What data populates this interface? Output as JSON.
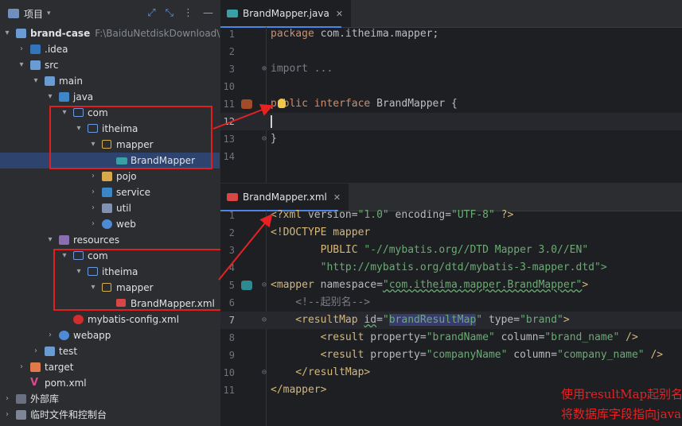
{
  "project_panel": {
    "title": "项目",
    "tree": [
      {
        "label": "brand-case",
        "hint": "F:\\BaiduNetdiskDownload\\资",
        "icon": "module-folder-icon",
        "bold": true
      },
      {
        "label": ".idea",
        "icon": "idea-folder-icon"
      },
      {
        "label": "src",
        "icon": "src-folder-icon"
      },
      {
        "label": "main",
        "icon": "folder-icon"
      },
      {
        "label": "java",
        "icon": "java-source-root-icon"
      },
      {
        "label": "com",
        "icon": "package-icon"
      },
      {
        "label": "itheima",
        "icon": "package-icon"
      },
      {
        "label": "mapper",
        "icon": "package-icon"
      },
      {
        "label": "BrandMapper",
        "icon": "mybatis-interface-icon"
      },
      {
        "label": "pojo",
        "icon": "package-icon"
      },
      {
        "label": "service",
        "icon": "package-icon"
      },
      {
        "label": "util",
        "icon": "package-icon"
      },
      {
        "label": "web",
        "icon": "package-icon"
      },
      {
        "label": "resources",
        "icon": "resources-root-icon"
      },
      {
        "label": "com",
        "icon": "folder-icon"
      },
      {
        "label": "itheima",
        "icon": "folder-icon"
      },
      {
        "label": "mapper",
        "icon": "folder-icon"
      },
      {
        "label": "BrandMapper.xml",
        "icon": "mapper-xml-icon"
      },
      {
        "label": "mybatis-config.xml",
        "icon": "mybatis-xml-icon"
      },
      {
        "label": "webapp",
        "icon": "web-folder-icon"
      },
      {
        "label": "test",
        "icon": "folder-icon"
      },
      {
        "label": "target",
        "icon": "excluded-folder-icon"
      },
      {
        "label": "pom.xml",
        "icon": "maven-icon"
      },
      {
        "label": "外部库",
        "icon": "library-icon"
      },
      {
        "label": "临时文件和控制台",
        "icon": "scratch-icon"
      }
    ]
  },
  "editor_java": {
    "tab": "BrandMapper.java",
    "tab_close": "✕",
    "lines": [
      {
        "n": "1"
      },
      {
        "n": "2"
      },
      {
        "n": "3"
      },
      {
        "n": "10"
      },
      {
        "n": "11"
      },
      {
        "n": "12"
      },
      {
        "n": "13"
      },
      {
        "n": "14"
      }
    ],
    "code": {
      "package_kw": "package",
      "package_name": " com.itheima.mapper;",
      "import_text": "import ...",
      "iface_pre": "p",
      "iface_rest": "ublic",
      "interface_kw": " interface",
      "class_name": " BrandMapper {",
      "close_brace": "}"
    }
  },
  "editor_xml": {
    "tab": "BrandMapper.xml",
    "tab_close": "✕",
    "lines": [
      {
        "n": "1"
      },
      {
        "n": "2"
      },
      {
        "n": "3"
      },
      {
        "n": "4"
      },
      {
        "n": "5"
      },
      {
        "n": "6"
      },
      {
        "n": "7"
      },
      {
        "n": "8"
      },
      {
        "n": "9"
      },
      {
        "n": "10"
      },
      {
        "n": "11"
      }
    ],
    "code": {
      "l1_a": "<?xml ",
      "l1_b": "version",
      "l1_c": "=",
      "l1_d": "\"1.0\"",
      "l1_e": " encoding",
      "l1_f": "=",
      "l1_g": "\"UTF-8\"",
      "l1_h": " ?>",
      "l2": "<!DOCTYPE mapper",
      "l3_a": "        PUBLIC ",
      "l3_b": "\"-//mybatis.org//DTD Mapper 3.0//EN\"",
      "l4": "        \"http://mybatis.org/dtd/mybatis-3-mapper.dtd\">",
      "l5_a": "<mapper ",
      "l5_b": "namespace",
      "l5_c": "=",
      "l5_d": "\"com.itheima.mapper.BrandMapper\"",
      "l5_e": ">",
      "l6": "    <!--起别名-->",
      "l7_a": "    <resultMap ",
      "l7_b": "id",
      "l7_c": "=",
      "l7_d": "\"",
      "l7_e": "brandResultMap",
      "l7_f": "\"",
      "l7_g": " type",
      "l7_h": "=",
      "l7_i": "\"brand\"",
      "l7_j": ">",
      "l8_a": "        <result ",
      "l8_b": "property",
      "l8_c": "=",
      "l8_d": "\"brandName\"",
      "l8_e": " column",
      "l8_f": "=",
      "l8_g": "\"brand_name\"",
      "l8_h": " />",
      "l9_a": "        <result ",
      "l9_b": "property",
      "l9_c": "=",
      "l9_d": "\"companyName\"",
      "l9_e": " column",
      "l9_f": "=",
      "l9_g": "\"company_name\"",
      "l9_h": " />",
      "l10": "    </resultMap>",
      "l11": "</mapper>"
    },
    "annotation_line1": "使用resultMap起别名特性",
    "annotation_line2": "将数据库字段指向java中定义的对象"
  },
  "colors": {
    "annotation": "#e62222",
    "selection": "#2e436e",
    "tab_underline": "#4a86e8"
  }
}
